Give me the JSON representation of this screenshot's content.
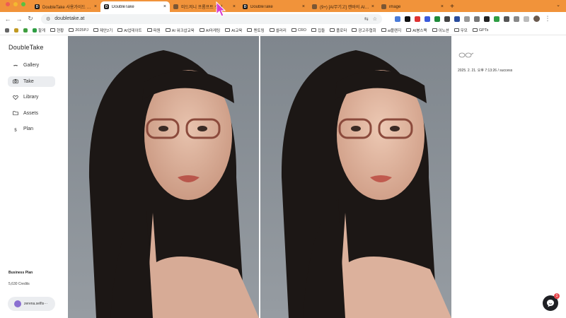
{
  "browser": {
    "tabs": [
      {
        "title": "DoubleTake 사용가이드 (_cami",
        "favicon": "D",
        "active": false
      },
      {
        "title": "DoubleTake",
        "favicon": "D",
        "active": true
      },
      {
        "title": "미드저니 프롬프트 생성",
        "favicon": "",
        "active": false
      },
      {
        "title": "DoubleTake",
        "favicon": "D",
        "active": false
      },
      {
        "title": "(9+) [AI무기고] 캔바의 AI통스팩",
        "favicon": "",
        "active": false
      },
      {
        "title": "image",
        "favicon": "",
        "active": false
      }
    ],
    "url": "doubletake.at",
    "colors": {
      "tab_strip": "#f1933a",
      "active_tab": "#ffffff"
    }
  },
  "bookmarks": [
    {
      "label": "",
      "type": "icon"
    },
    {
      "label": "",
      "type": "icon"
    },
    {
      "label": "",
      "type": "icon"
    },
    {
      "label": "할게",
      "type": "icon"
    },
    {
      "label": "현황",
      "type": "folder"
    },
    {
      "label": "2025PJ",
      "type": "folder"
    },
    {
      "label": "제안2기",
      "type": "folder"
    },
    {
      "label": "AI업데이트",
      "type": "folder"
    },
    {
      "label": "파원",
      "type": "folder"
    },
    {
      "label": "AI 워크샵교육",
      "type": "folder"
    },
    {
      "label": "AI마케팅",
      "type": "folder"
    },
    {
      "label": "AI교육",
      "type": "folder"
    },
    {
      "label": "멘토링",
      "type": "folder"
    },
    {
      "label": "셀러리",
      "type": "folder"
    },
    {
      "label": "CRO",
      "type": "folder"
    },
    {
      "label": "집들",
      "type": "folder"
    },
    {
      "label": "플로터",
      "type": "folder"
    },
    {
      "label": "광고주협회",
      "type": "folder"
    },
    {
      "label": "ai플랜지",
      "type": "folder"
    },
    {
      "label": "AI봉스팩",
      "type": "folder"
    },
    {
      "label": "이노션",
      "type": "folder"
    },
    {
      "label": "우모",
      "type": "folder"
    },
    {
      "label": "GPTs",
      "type": "folder"
    }
  ],
  "sidebar": {
    "brand": "DoubleTake",
    "items": [
      {
        "label": "Gallery",
        "icon": "mustache-icon",
        "active": false
      },
      {
        "label": "Take",
        "icon": "camera-icon",
        "active": true
      },
      {
        "label": "Library",
        "icon": "heart-icon",
        "active": false
      },
      {
        "label": "Assets",
        "icon": "folder-icon",
        "active": false
      },
      {
        "label": "Plan",
        "icon": "dollar-icon",
        "active": false
      }
    ],
    "plan": "Business Plan",
    "credits": "5,630 Credits",
    "user": "zerena.selfis···"
  },
  "result": {
    "meta": "2025. 2. 21. 오후 7:13:26 / success",
    "thumbnail_icon": "glasses-icon"
  },
  "chat": {
    "badge": "1",
    "icon": "chat-icon"
  }
}
